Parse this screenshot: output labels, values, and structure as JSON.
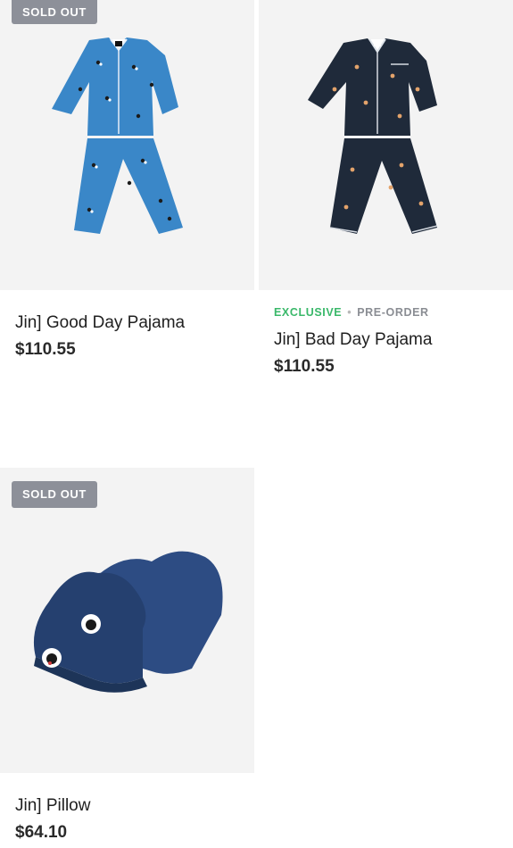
{
  "products": [
    {
      "badge": "SOLD OUT",
      "title": "Jin] Good Day Pajama",
      "price": "$110.55",
      "image_color": "#3a87c8"
    },
    {
      "tags": [
        "EXCLUSIVE",
        "PRE-ORDER"
      ],
      "tag_separator": "•",
      "title": "Jin] Bad Day Pajama",
      "price": "$110.55",
      "image_color": "#1f2a3a"
    },
    {
      "badge": "SOLD OUT",
      "title": "Jin] Pillow",
      "price": "$64.10",
      "image_color": "#2d4c83"
    }
  ]
}
